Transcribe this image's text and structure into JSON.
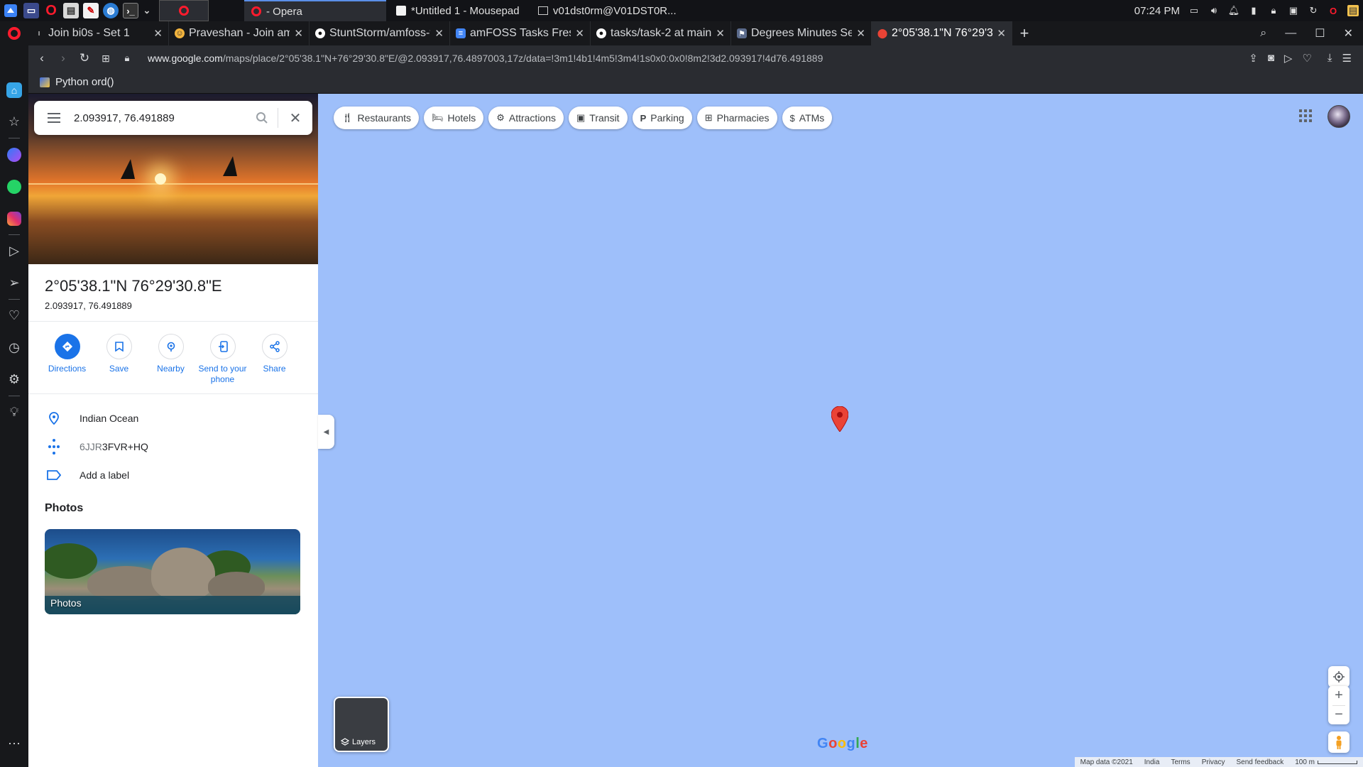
{
  "os_panel": {
    "tasks": [
      {
        "label": "- Opera",
        "active": true
      },
      {
        "label": "*Untitled 1 - Mousepad",
        "active": false
      },
      {
        "label": "v01dst0rm@V01DST0R...",
        "active": false
      }
    ],
    "clock": "07:24 PM"
  },
  "browser": {
    "tabs": [
      {
        "title": "Join bi0s - Set 1",
        "active": false
      },
      {
        "title": "Praveshan - Join amF",
        "active": false
      },
      {
        "title": "StuntStorm/amfoss-t",
        "active": false
      },
      {
        "title": "amFOSS Tasks Fresh",
        "active": false
      },
      {
        "title": "tasks/task-2 at main",
        "active": false
      },
      {
        "title": "Degrees Minutes Sec",
        "active": false
      },
      {
        "title": "2°05'38.1\"N 76°29'3",
        "active": true
      }
    ],
    "url_host": "www.google.com",
    "url_path": "/maps/place/2°05'38.1\"N+76°29'30.8\"E/@2.093917,76.4897003,17z/data=!3m1!4b1!4m5!3m4!1s0x0:0x0!8m2!3d2.093917!4d76.491889",
    "bookmark": "Python ord()"
  },
  "maps": {
    "search_value": "2.093917, 76.491889",
    "place_title": "2°05'38.1\"N 76°29'30.8\"E",
    "place_coords": "2.093917, 76.491889",
    "actions": {
      "directions": "Directions",
      "save": "Save",
      "nearby": "Nearby",
      "send_line1": "Send to your",
      "send_line2": "phone",
      "share": "Share"
    },
    "info": {
      "location": "Indian Ocean",
      "pluscode_prefix": "6JJR",
      "pluscode_rest": "3FVR+HQ",
      "add_label": "Add a label"
    },
    "photos_heading": "Photos",
    "photos_card_label": "Photos",
    "chips": [
      "Restaurants",
      "Hotels",
      "Attractions",
      "Transit",
      "Parking",
      "Pharmacies",
      "ATMs"
    ],
    "layers_label": "Layers",
    "footer": {
      "map_data": "Map data ©2021",
      "region": "India",
      "terms": "Terms",
      "privacy": "Privacy",
      "feedback": "Send feedback",
      "scale": "100 m"
    },
    "water_color": "#9ebffa",
    "accent": "#1a73e8",
    "pin_color": "#ea4335"
  }
}
